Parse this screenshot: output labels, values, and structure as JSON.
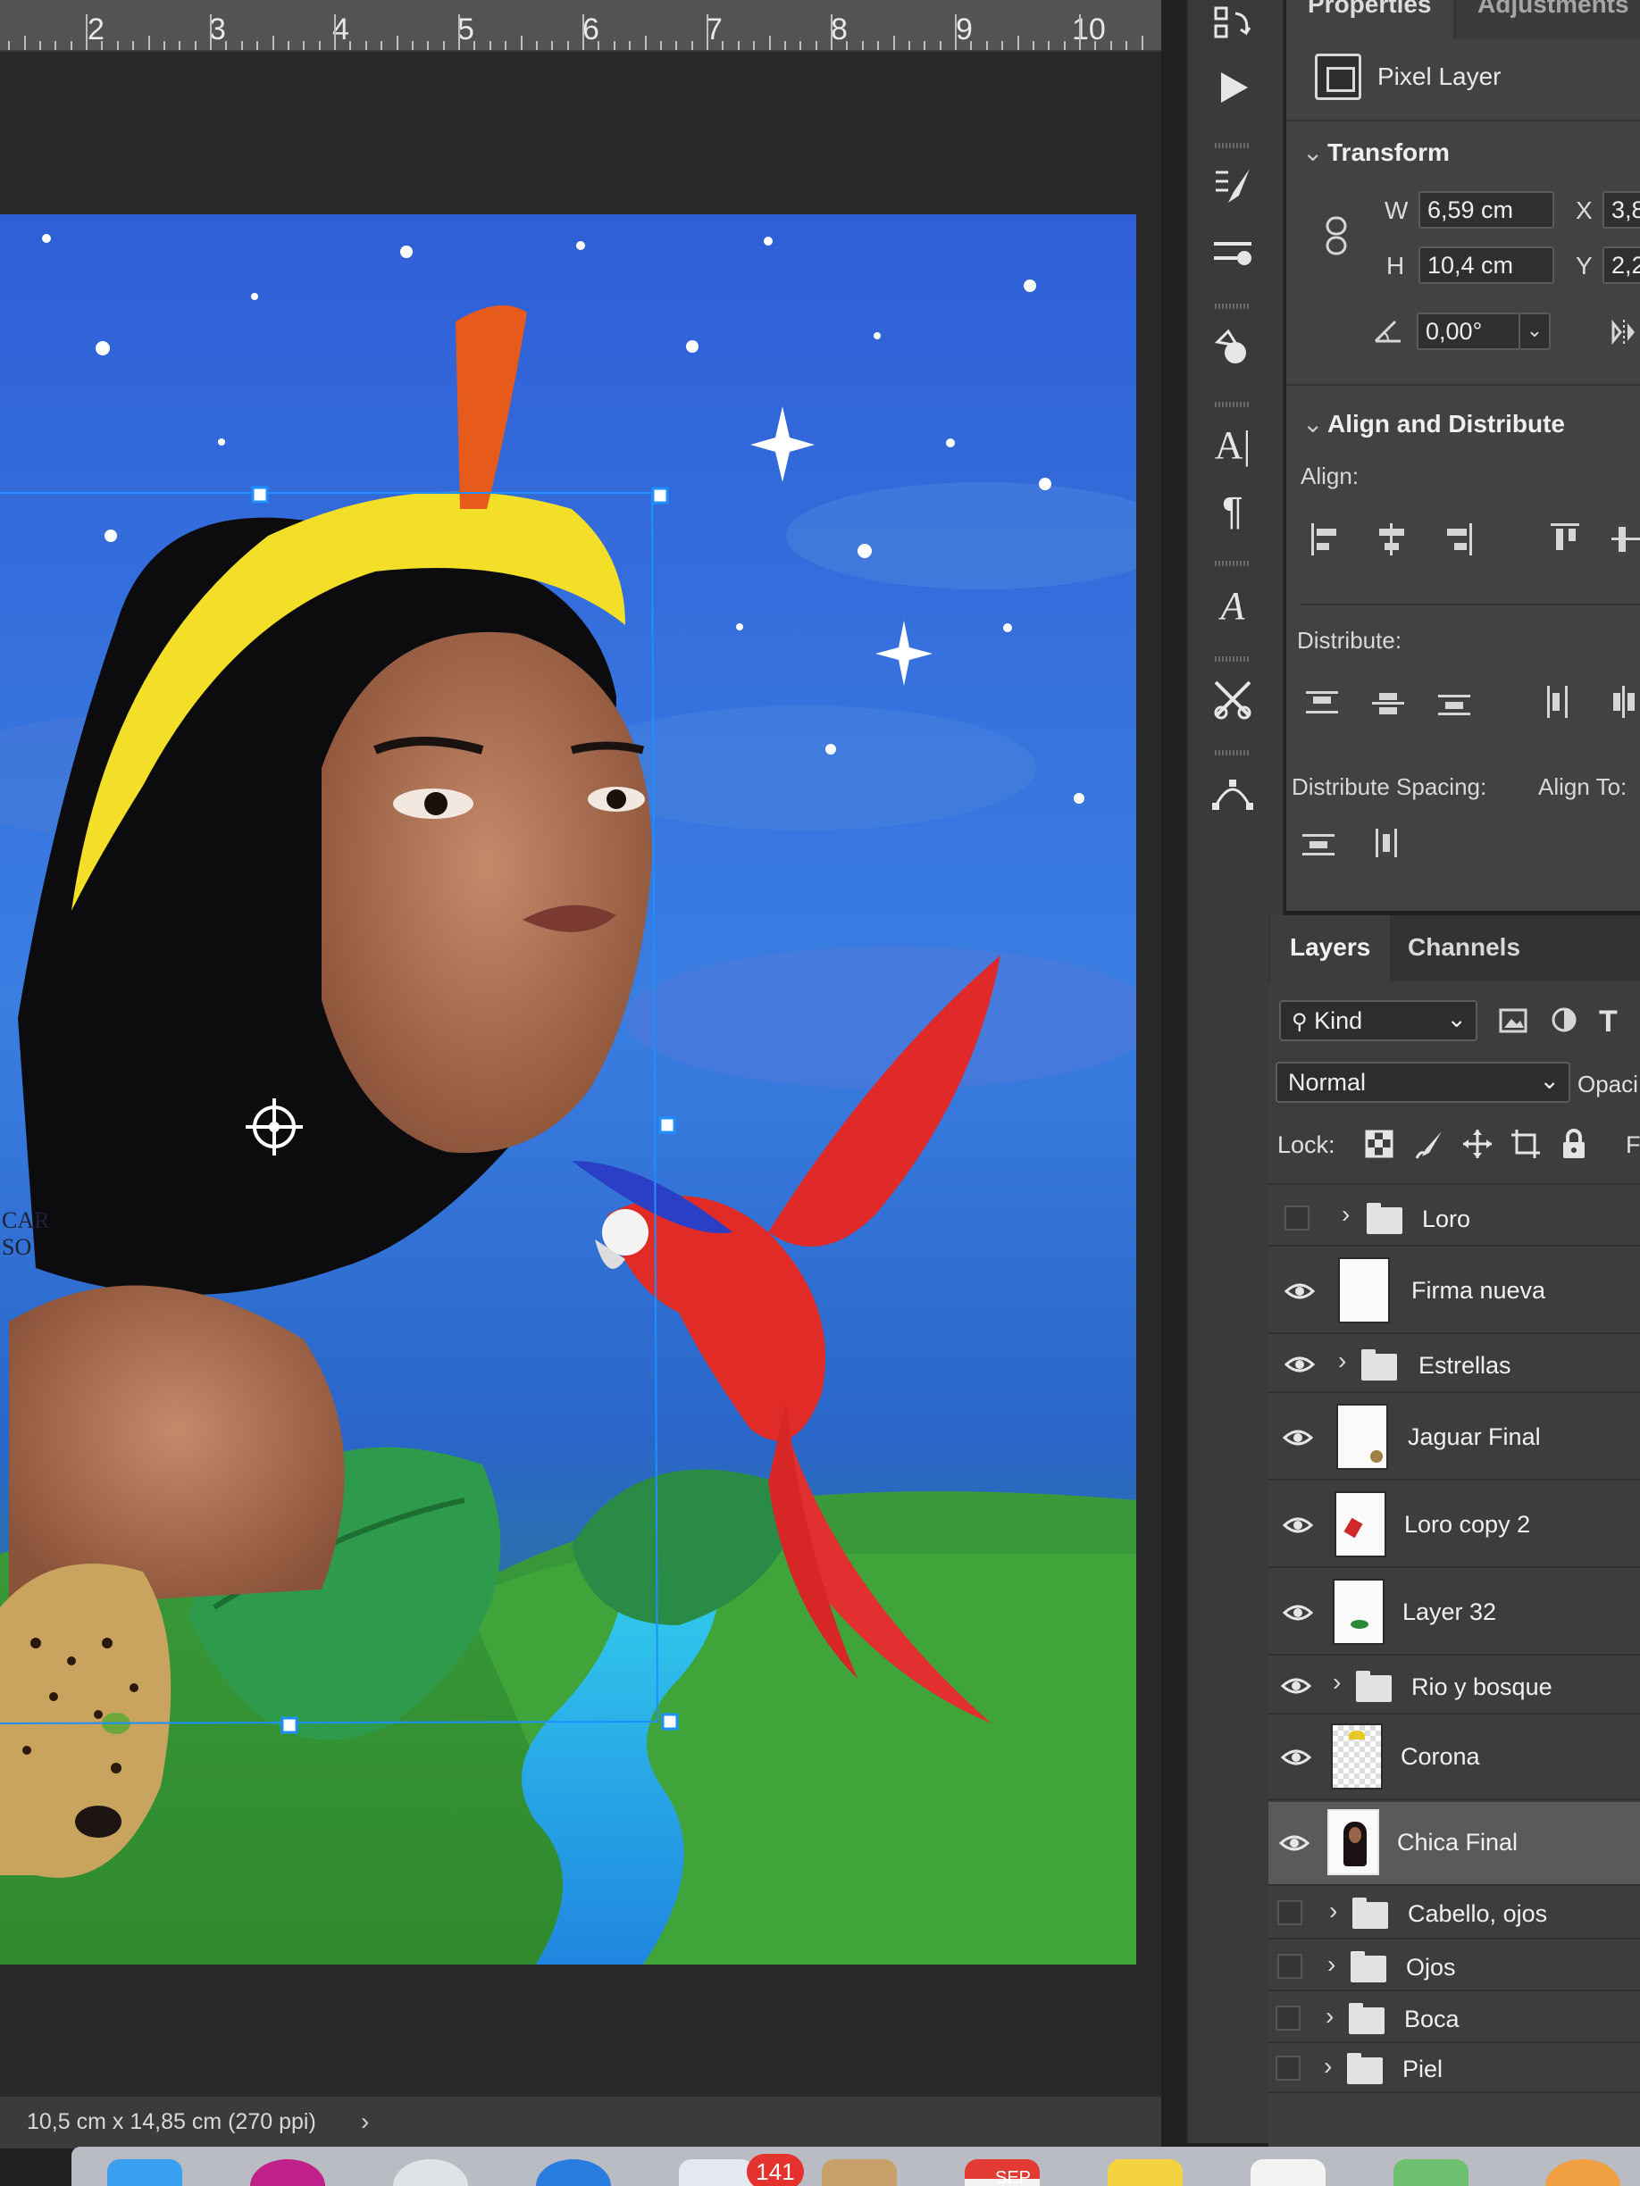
{
  "ruler": {
    "ticks": [
      "2",
      "3",
      "4",
      "5",
      "6",
      "7",
      "8",
      "9",
      "10"
    ]
  },
  "status_bar": {
    "doc_info": "10,5 cm x 14,85 cm (270 ppi)",
    "chevron": "›"
  },
  "watermark": [
    "CAR",
    "SO"
  ],
  "properties": {
    "tabs": [
      "Properties",
      "Adjustments"
    ],
    "layer_kind": "Pixel Layer",
    "transform": {
      "title": "Transform",
      "w_label": "W",
      "w_value": "6,59 cm",
      "h_label": "H",
      "h_value": "10,4 cm",
      "x_label": "X",
      "x_value": "3,8",
      "y_label": "Y",
      "y_value": "2,2",
      "angle_value": "0,00°"
    },
    "align": {
      "title": "Align and Distribute",
      "align_label": "Align:",
      "distribute_label": "Distribute:",
      "spacing_label": "Distribute Spacing:",
      "align_to_label": "Align To:"
    }
  },
  "layers_panel": {
    "tabs": [
      "Layers",
      "Channels"
    ],
    "filter": "Kind",
    "blend_mode": "Normal",
    "opacity_label": "Opaci",
    "lock_label": "Lock:",
    "fill_label": "F",
    "layers": [
      {
        "name": "Loro",
        "type": "group",
        "visible": false
      },
      {
        "name": "Firma nueva",
        "type": "layer",
        "visible": true
      },
      {
        "name": "Estrellas",
        "type": "group",
        "visible": true
      },
      {
        "name": "Jaguar Final",
        "type": "layer",
        "visible": true
      },
      {
        "name": "Loro copy 2",
        "type": "layer",
        "visible": true
      },
      {
        "name": "Layer 32",
        "type": "layer",
        "visible": true
      },
      {
        "name": "Rio y bosque",
        "type": "group",
        "visible": true
      },
      {
        "name": "Corona",
        "type": "layer",
        "visible": true
      },
      {
        "name": "Chica Final",
        "type": "layer",
        "visible": true,
        "selected": true
      },
      {
        "name": "Cabello, ojos",
        "type": "group",
        "visible": false
      },
      {
        "name": "Ojos",
        "type": "group",
        "visible": false
      },
      {
        "name": "Boca",
        "type": "group",
        "visible": false
      },
      {
        "name": "Piel",
        "type": "group",
        "visible": false
      }
    ]
  },
  "dock": {
    "mail_badge": "141",
    "calendar_month": "SEP"
  },
  "colors": {
    "panel": "#424242",
    "selection": "#1e8fff",
    "accent_blue": "#2d6fe0"
  }
}
